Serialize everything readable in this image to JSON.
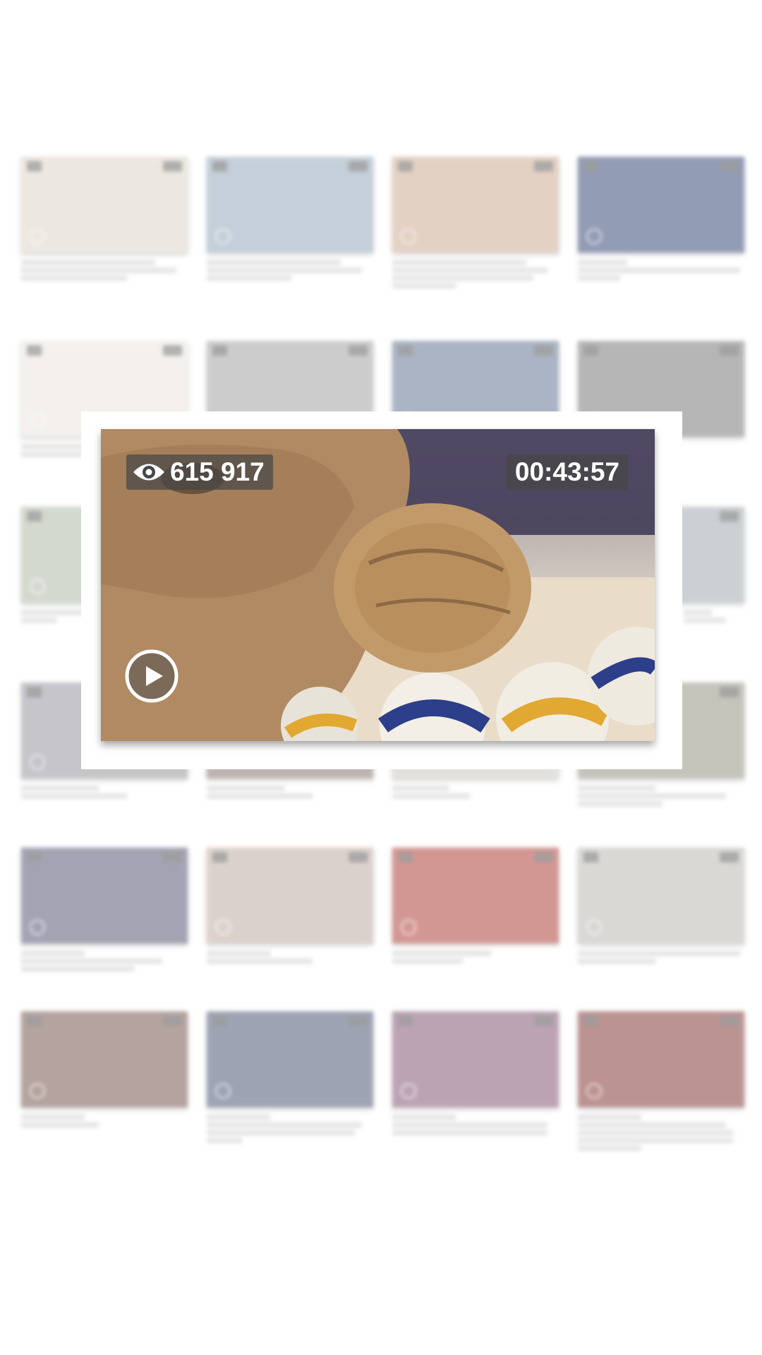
{
  "overlay": {
    "views": "615 917",
    "duration": "00:43:57"
  },
  "grid": [
    {
      "thumb_color": "#d9d1c4"
    },
    {
      "thumb_color": "#8aa0b4"
    },
    {
      "thumb_color": "#c9a48a"
    },
    {
      "thumb_color": "#2a3b6e"
    },
    {
      "thumb_color": "#e8e2dc"
    },
    {
      "thumb_color": "#9b9b9b"
    },
    {
      "thumb_color": "#5a6b8a"
    },
    {
      "thumb_color": "#6f6f6f"
    },
    {
      "thumb_color": "#a9b4a0"
    },
    {
      "thumb_color": "#9aa2a8"
    },
    {
      "thumb_color": "#8d8d96"
    },
    {
      "thumb_color": "#7d6c68"
    },
    {
      "thumb_color": "#c9c2bd"
    },
    {
      "thumb_color": "#8c8a7a"
    },
    {
      "thumb_color": "#4a4a6a"
    },
    {
      "thumb_color": "#b9a59a"
    },
    {
      "thumb_color": "#a8322a"
    },
    {
      "thumb_color": "#b4b2ac"
    },
    {
      "thumb_color": "#6b4a42"
    },
    {
      "thumb_color": "#3e4a6a"
    },
    {
      "thumb_color": "#7a4a6a"
    },
    {
      "thumb_color": "#7a2a26"
    },
    {
      "thumb_color": "#8a6aa8"
    },
    {
      "thumb_color": "#8a2a22"
    }
  ]
}
